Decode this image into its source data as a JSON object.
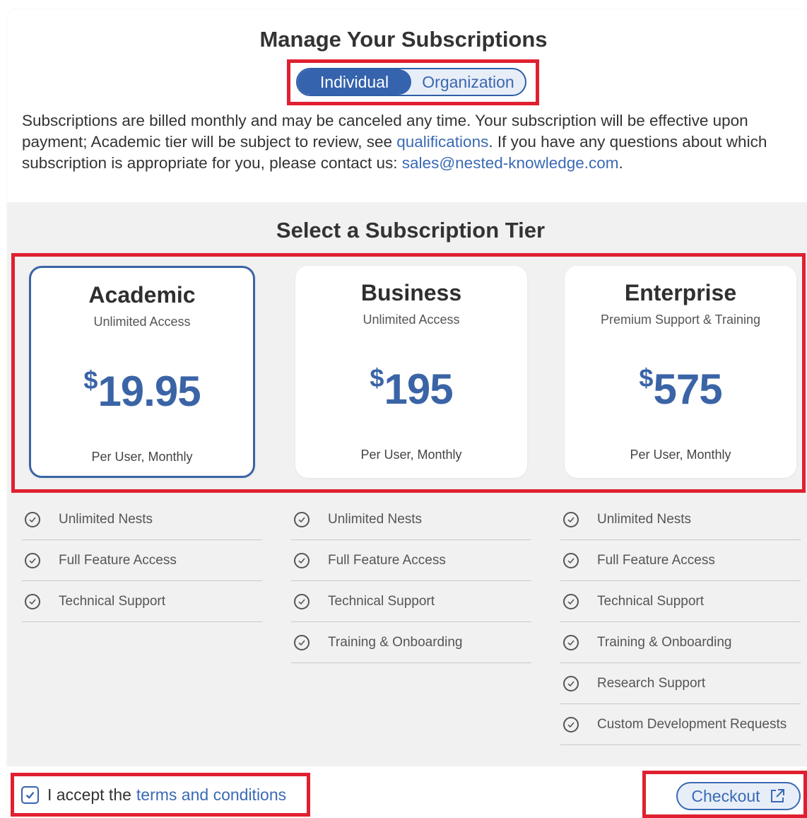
{
  "header": {
    "title": "Manage Your Subscriptions",
    "toggle": {
      "options": [
        "Individual",
        "Organization"
      ],
      "selected": "Individual"
    },
    "intro": {
      "part1": "Subscriptions are billed monthly and may be canceled any time. Your subscription will be effective upon payment; Academic tier will be subject to review, see ",
      "link1": "qualifications",
      "part2": ". If you have any questions about which subscription is appropriate for you, please contact us: ",
      "link2": "sales@nested-knowledge.com",
      "part3": "."
    }
  },
  "tiers_section": {
    "title": "Select a Subscription Tier",
    "tiers": [
      {
        "name": "Academic",
        "subtitle": "Unlimited Access",
        "currency": "$",
        "price": "19.95",
        "period": "Per User, Monthly",
        "selected": true,
        "features": [
          "Unlimited Nests",
          "Full Feature Access",
          "Technical Support"
        ]
      },
      {
        "name": "Business",
        "subtitle": "Unlimited Access",
        "currency": "$",
        "price": "195",
        "period": "Per User, Monthly",
        "selected": false,
        "features": [
          "Unlimited Nests",
          "Full Feature Access",
          "Technical Support",
          "Training & Onboarding"
        ]
      },
      {
        "name": "Enterprise",
        "subtitle": "Premium Support & Training",
        "currency": "$",
        "price": "575",
        "period": "Per User, Monthly",
        "selected": false,
        "features": [
          "Unlimited Nests",
          "Full Feature Access",
          "Technical Support",
          "Training & Onboarding",
          "Research Support",
          "Custom Development Requests"
        ]
      }
    ]
  },
  "footer": {
    "accept_prefix": "I accept the",
    "accept_link": "terms and conditions",
    "accept_checked": true,
    "checkout_label": "Checkout",
    "checkout_icon": "external-link-icon"
  },
  "colors": {
    "accent": "#3563ad",
    "highlight": "#e02030",
    "section_bg": "#f1f1f1"
  }
}
